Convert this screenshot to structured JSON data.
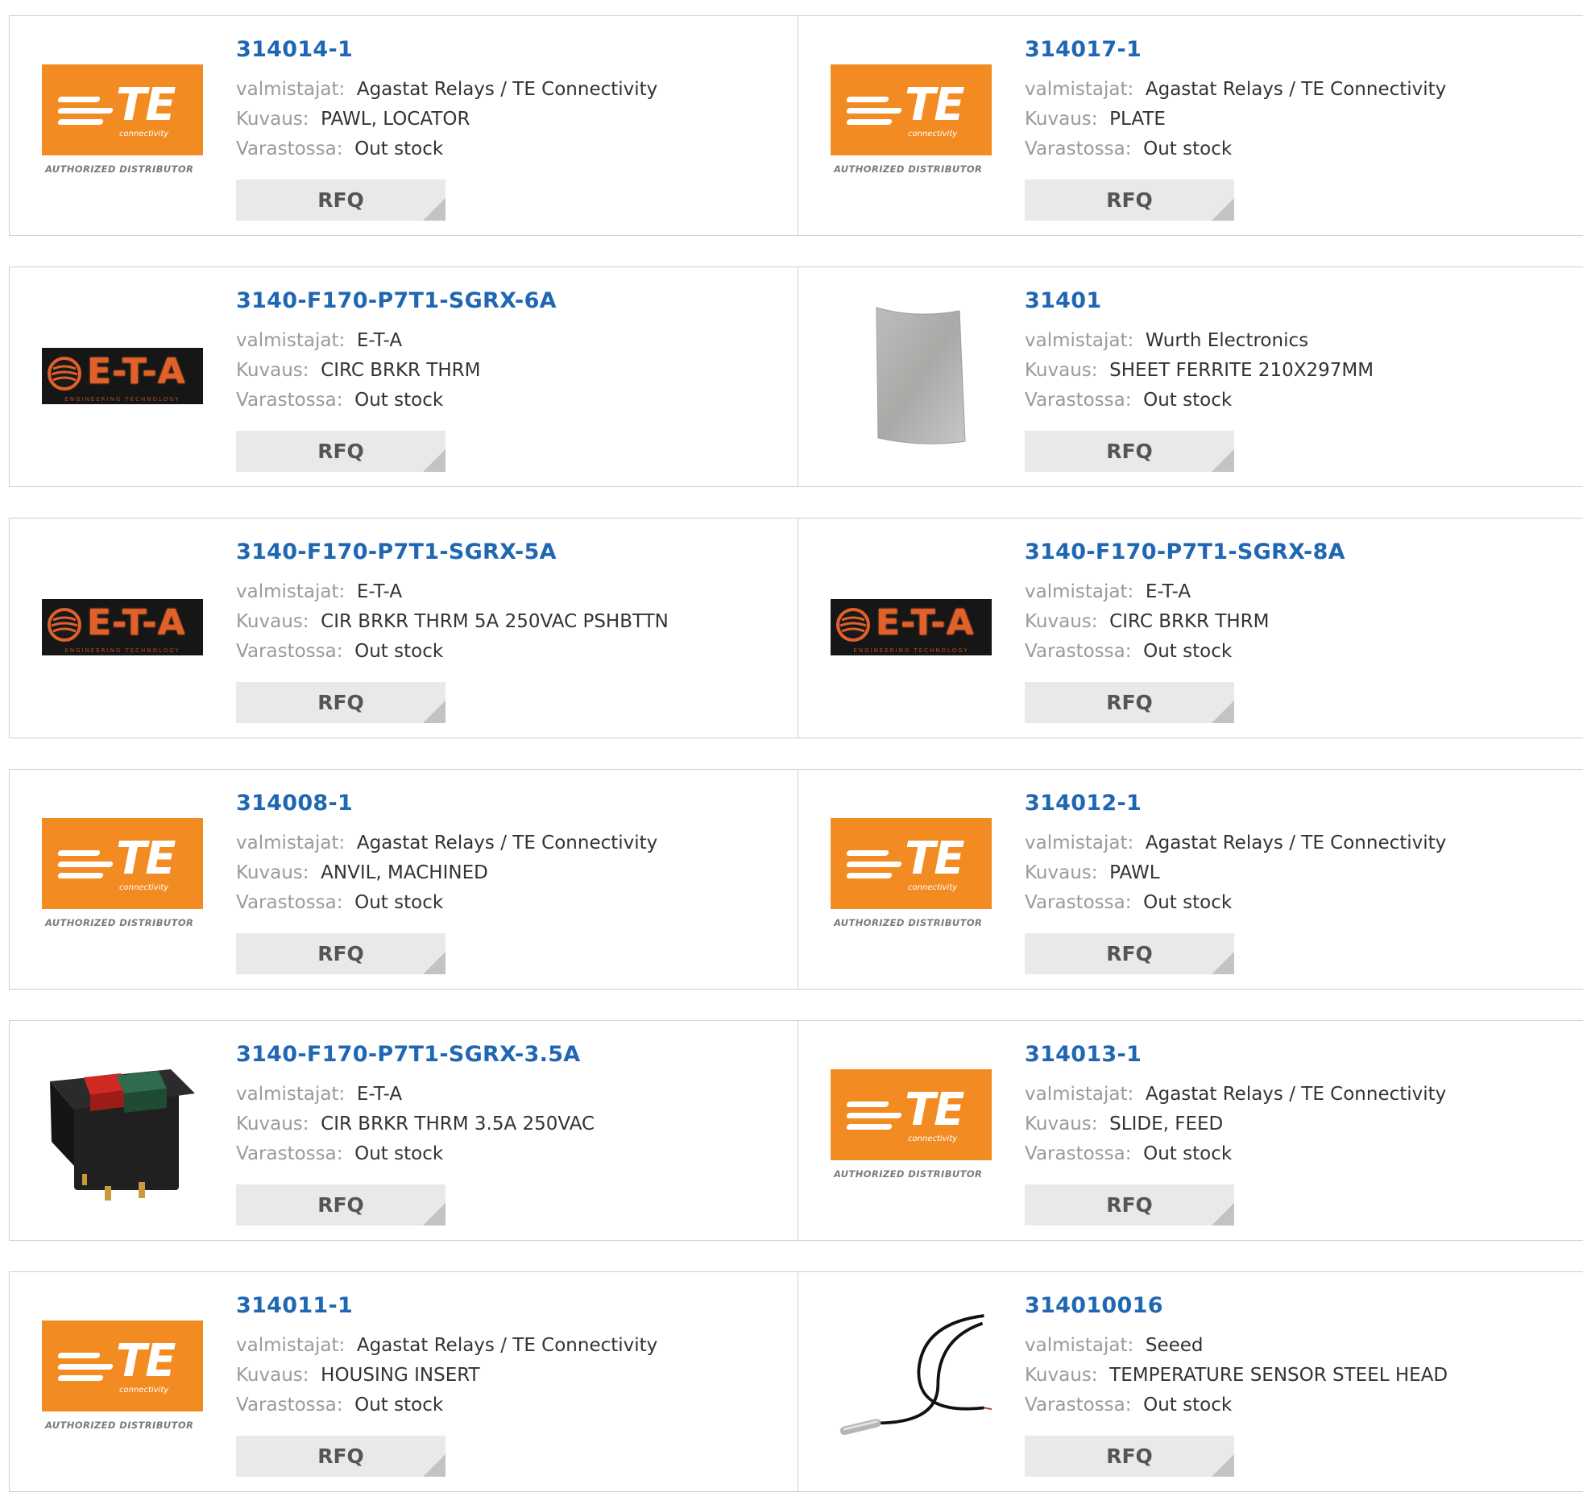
{
  "labels": {
    "manufacturer": "valmistajat:",
    "description": "Kuvaus:",
    "stock": "Varastossa:",
    "rfq": "RFQ"
  },
  "logos": {
    "te_text": "TE",
    "te_sub": "connectivity",
    "te_authorized": "AUTHORIZED DISTRIBUTOR",
    "eta_text": "E-T-A",
    "eta_sub": "ENGINEERING TECHNOLOGY"
  },
  "colors": {
    "link": "#1f66b3",
    "te_orange": "#f28c22",
    "eta_orange": "#e2602a",
    "rfq_bg": "#e9e9e9"
  },
  "products": [
    {
      "part": "314014-1",
      "manufacturer": "Agastat Relays / TE Connectivity",
      "description": "PAWL, LOCATOR",
      "stock": "Out stock",
      "image": "te-logo"
    },
    {
      "part": "314017-1",
      "manufacturer": "Agastat Relays / TE Connectivity",
      "description": "PLATE",
      "stock": "Out stock",
      "image": "te-logo"
    },
    {
      "part": "3140-F170-P7T1-SGRX-6A",
      "manufacturer": "E-T-A",
      "description": "CIRC BRKR THRM",
      "stock": "Out stock",
      "image": "eta-logo"
    },
    {
      "part": "31401",
      "manufacturer": "Wurth Electronics",
      "description": "SHEET FERRITE 210X297MM",
      "stock": "Out stock",
      "image": "ferrite-sheet"
    },
    {
      "part": "3140-F170-P7T1-SGRX-5A",
      "manufacturer": "E-T-A",
      "description": "CIR BRKR THRM 5A 250VAC PSHBTTN",
      "stock": "Out stock",
      "image": "eta-logo"
    },
    {
      "part": "3140-F170-P7T1-SGRX-8A",
      "manufacturer": "E-T-A",
      "description": "CIRC BRKR THRM",
      "stock": "Out stock",
      "image": "eta-logo"
    },
    {
      "part": "314008-1",
      "manufacturer": "Agastat Relays / TE Connectivity",
      "description": "ANVIL, MACHINED",
      "stock": "Out stock",
      "image": "te-logo"
    },
    {
      "part": "314012-1",
      "manufacturer": "Agastat Relays / TE Connectivity",
      "description": "PAWL",
      "stock": "Out stock",
      "image": "te-logo"
    },
    {
      "part": "3140-F170-P7T1-SGRX-3.5A",
      "manufacturer": "E-T-A",
      "description": "CIR BRKR THRM 3.5A 250VAC",
      "stock": "Out stock",
      "image": "breaker-switch"
    },
    {
      "part": "314013-1",
      "manufacturer": "Agastat Relays / TE Connectivity",
      "description": "SLIDE, FEED",
      "stock": "Out stock",
      "image": "te-logo"
    },
    {
      "part": "314011-1",
      "manufacturer": "Agastat Relays / TE Connectivity",
      "description": "HOUSING INSERT",
      "stock": "Out stock",
      "image": "te-logo"
    },
    {
      "part": "314010016",
      "manufacturer": "Seeed",
      "description": "TEMPERATURE SENSOR STEEL HEAD",
      "stock": "Out stock",
      "image": "temperature-probe"
    }
  ]
}
